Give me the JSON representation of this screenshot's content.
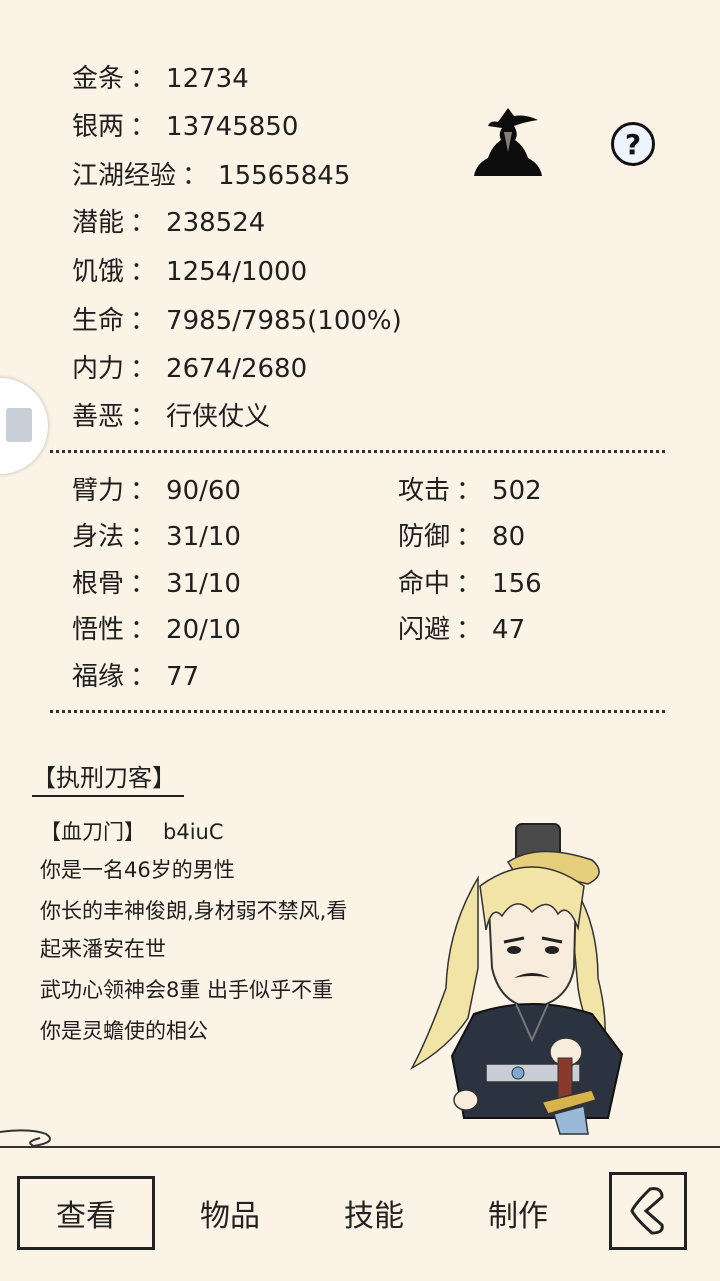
{
  "stats": [
    {
      "label": "金条",
      "sep": "：",
      "value": "12734"
    },
    {
      "label": "银两",
      "sep": "：",
      "value": "13745850"
    },
    {
      "label": "江湖经验",
      "sep": "：",
      "value": "15565845"
    },
    {
      "label": "潜能",
      "sep": "：",
      "value": "238524"
    },
    {
      "label": "饥饿",
      "sep": "：",
      "value": "1254/1000"
    },
    {
      "label": "生命",
      "sep": "：",
      "value": "7985/7985(100%)"
    },
    {
      "label": "内力",
      "sep": "：",
      "value": "2674/2680"
    },
    {
      "label": "善恶",
      "sep": "：",
      "value": "行侠仗义"
    }
  ],
  "attributes_left": [
    {
      "label": "臂力",
      "sep": "：",
      "value": "90/60"
    },
    {
      "label": "身法",
      "sep": "：",
      "value": "31/10"
    },
    {
      "label": "根骨",
      "sep": "：",
      "value": "31/10"
    },
    {
      "label": "悟性",
      "sep": "：",
      "value": "20/10"
    },
    {
      "label": "福缘",
      "sep": "：",
      "value": "77"
    }
  ],
  "attributes_right": [
    {
      "label": "攻击",
      "sep": "：",
      "value": "502"
    },
    {
      "label": "防御",
      "sep": "：",
      "value": "80"
    },
    {
      "label": "命中",
      "sep": "：",
      "value": "156"
    },
    {
      "label": "闪避",
      "sep": "：",
      "value": "47"
    }
  ],
  "character": {
    "title": "【执刑刀客】",
    "faction": "【血刀门】",
    "name": "b4iuC",
    "bio": [
      "你是一名46岁的男性",
      "你长的丰神俊朗,身材弱不禁风,看",
      "起来潘安在世",
      "武功心领神会8重 出手似乎不重",
      "你是灵蟾使的相公"
    ]
  },
  "help": {
    "symbol": "?"
  },
  "nav": {
    "tabs": [
      "查看",
      "物品",
      "技能",
      "制作"
    ],
    "active_index": 0
  }
}
